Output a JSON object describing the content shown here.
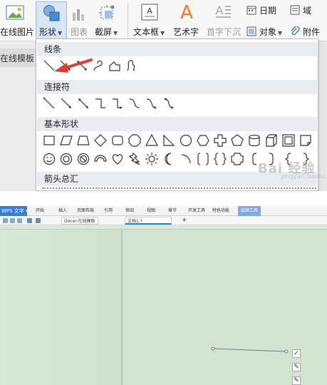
{
  "ribbon": {
    "online_picture": "在线图片",
    "shape": "形状",
    "chart": "图表",
    "screenshot": "截屏",
    "textbox": "文本框",
    "wordart": "艺术字",
    "dropcap": "首字下沉",
    "date": "日期",
    "object": "对象",
    "field": "域",
    "attachment": "附件"
  },
  "left_tab": "在线模板",
  "gallery": {
    "sections": [
      {
        "title": "线条",
        "shapes": [
          "line",
          "line-arrow",
          "line-double-arrow",
          "curve",
          "freeform",
          "scribble"
        ]
      },
      {
        "title": "连接符",
        "shapes": [
          "straight-connector",
          "straight-arrow-connector",
          "straight-double-arrow-connector",
          "elbow-connector",
          "elbow-arrow-connector",
          "curved-connector",
          "curved-arrow-connector",
          "curved-double-arrow-connector"
        ]
      },
      {
        "title": "基本形状",
        "shapes": [
          "rectangle",
          "parallelogram",
          "trapezoid",
          "diamond",
          "rounded-rectangle",
          "octagon",
          "triangle",
          "right-triangle",
          "ellipse",
          "hexagon",
          "cross",
          "pentagon",
          "cylinder",
          "cube",
          "frame",
          "folded-corner",
          "smiley",
          "donut",
          "no-symbol",
          "block-arc",
          "heart",
          "lightning",
          "sun",
          "moon",
          "arc",
          "double-bracket",
          "double-brace",
          "plaque",
          "left-bracket",
          "right-bracket",
          "left-brace",
          "right-brace"
        ]
      },
      {
        "title": "箭头总汇",
        "shapes": []
      }
    ]
  },
  "watermark": "Bai 经验",
  "watermark_sub": "jingyan.baidu.com",
  "editor": {
    "app_button": "WPS 文字",
    "menu_tabs": [
      "开始",
      "插入",
      "页面布局",
      "引用",
      "审阅",
      "视图",
      "章节",
      "开发工具",
      "特色功能",
      "绘图工具"
    ],
    "doc_tabs": [
      "Docer-在线模板",
      "文档1 *"
    ],
    "new_tab": "+"
  },
  "colors": {
    "accent_blue": "#3a7bd5",
    "annotation_red": "#e03a2f",
    "page_green": "#cfe3cf"
  }
}
